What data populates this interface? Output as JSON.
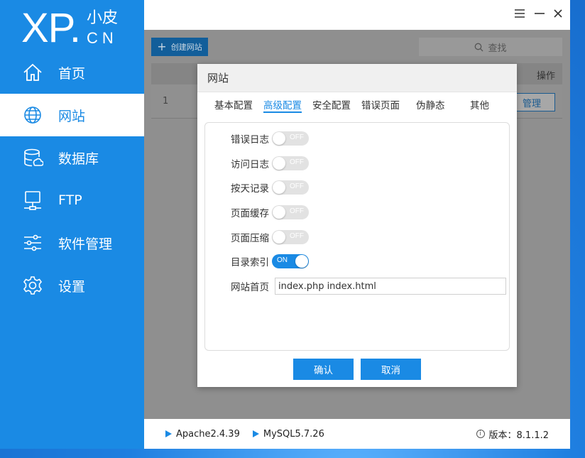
{
  "logo": {
    "main": "XP.",
    "top": "小皮",
    "bottom": "CN"
  },
  "nav": [
    {
      "label": "首页",
      "icon": "home-icon"
    },
    {
      "label": "网站",
      "icon": "globe-icon",
      "active": true
    },
    {
      "label": "数据库",
      "icon": "database-icon"
    },
    {
      "label": "FTP",
      "icon": "ftp-icon"
    },
    {
      "label": "软件管理",
      "icon": "sliders-icon"
    },
    {
      "label": "设置",
      "icon": "gear-icon"
    }
  ],
  "toolbar": {
    "create_label": "创建网站",
    "search_placeholder": "查找"
  },
  "table": {
    "op_header": "操作",
    "rows": [
      {
        "num": "1",
        "action": "管理"
      }
    ]
  },
  "dialog": {
    "title": "网站",
    "tabs": [
      "基本配置",
      "高级配置",
      "安全配置",
      "错误页面",
      "伪静态",
      "其他"
    ],
    "active_tab": "高级配置",
    "toggles": [
      {
        "label": "错误日志",
        "state": "OFF"
      },
      {
        "label": "访问日志",
        "state": "OFF"
      },
      {
        "label": "按天记录",
        "state": "OFF"
      },
      {
        "label": "页面缓存",
        "state": "OFF"
      },
      {
        "label": "页面压缩",
        "state": "OFF"
      },
      {
        "label": "目录索引",
        "state": "ON"
      }
    ],
    "index_label": "网站首页",
    "index_value": "index.php index.html",
    "confirm_label": "确认",
    "cancel_label": "取消"
  },
  "footer": {
    "services": [
      "Apache2.4.39",
      "MySQL5.7.26"
    ],
    "version_label": "版本：8.1.1.2"
  },
  "colors": {
    "accent": "#1a8ae4"
  }
}
